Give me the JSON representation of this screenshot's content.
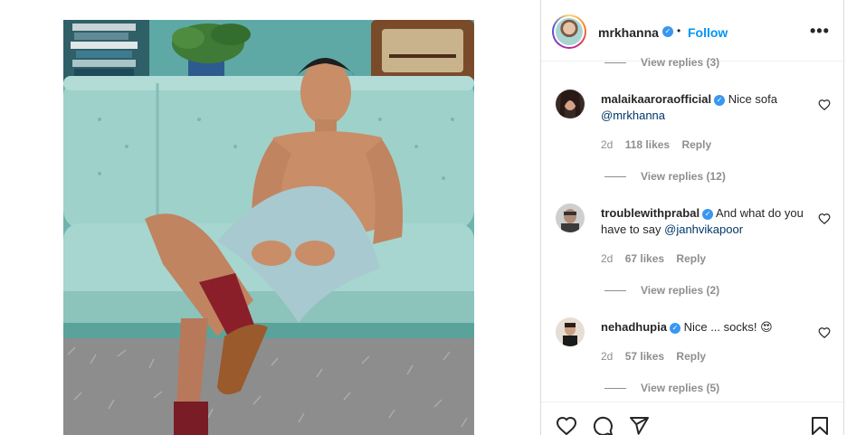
{
  "post": {
    "username": "mrkhanna",
    "separator": "•",
    "follow_label": "Follow",
    "more_label": "•••"
  },
  "comments": [
    {
      "username": "malaikaarora official",
      "username_display": "malaikaaroraofficial",
      "text": "Nice sofa",
      "mention": "@mrkhanna",
      "age": "2d",
      "likes": "118 likes",
      "reply_label": "Reply",
      "view_replies": "View replies (12)"
    },
    {
      "username_display": "troublewithprabal",
      "text": "And what do you have to say",
      "mention": "@janhvikapoor",
      "age": "2d",
      "likes": "67 likes",
      "reply_label": "Reply",
      "view_replies": "View replies (2)"
    },
    {
      "username_display": "nehadhupia",
      "text": "Nice ... socks!",
      "emoji": "😍",
      "age": "2d",
      "likes": "57 likes",
      "reply_label": "Reply",
      "view_replies": "View replies (5)"
    }
  ],
  "top_view_replies": "View replies (3)",
  "icons": {
    "like": "heart-icon",
    "comment": "comment-icon",
    "share": "share-icon",
    "save": "bookmark-icon",
    "verified": "verified-badge-icon",
    "more": "more-icon"
  },
  "colors": {
    "accent": "#0095f6",
    "verified": "#3897f0",
    "muted": "#8e8e8e",
    "text": "#262626",
    "mention": "#00376b"
  }
}
